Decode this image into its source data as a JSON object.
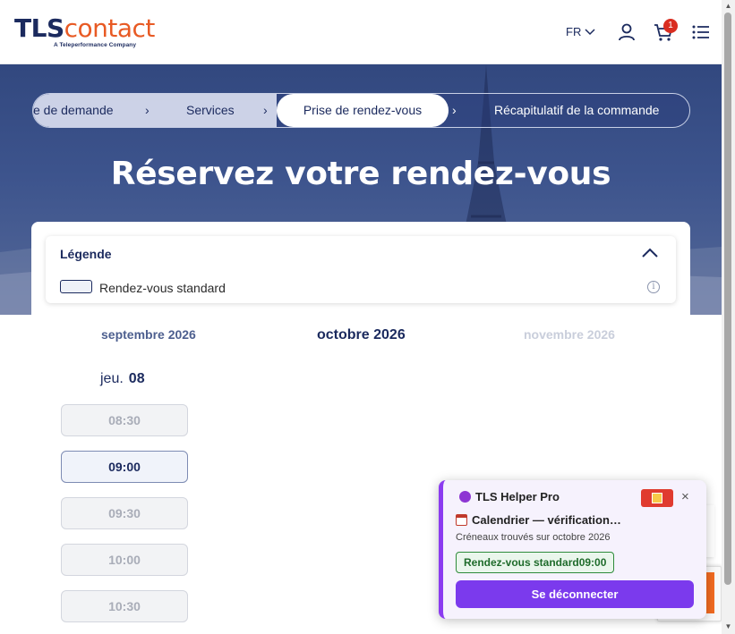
{
  "header": {
    "logo_tls": "TLS",
    "logo_contact": "contact",
    "logo_tagline": "A Teleperformance Company",
    "language": "FR",
    "cart_count": "1"
  },
  "stepper": {
    "steps": [
      "e de demande",
      "Services",
      "Prise de rendez-vous",
      "Récapitulatif de la commande"
    ],
    "active_index": 2
  },
  "hero": {
    "title": "Réservez votre rendez-vous"
  },
  "legend": {
    "title": "Légende",
    "items": [
      "Rendez-vous standard"
    ],
    "info_glyph": "i"
  },
  "calendar": {
    "months": {
      "prev": "septembre 2026",
      "current": "octobre 2026",
      "next": "novembre 2026"
    },
    "day": {
      "weekday": "jeu.",
      "number": "08"
    },
    "slots": [
      {
        "time": "08:30",
        "available": false
      },
      {
        "time": "09:00",
        "available": true
      },
      {
        "time": "09:30",
        "available": false
      },
      {
        "time": "10:00",
        "available": false
      },
      {
        "time": "10:30",
        "available": false
      }
    ]
  },
  "helper": {
    "title": "TLS Helper Pro",
    "status": "Calendrier — vérification…",
    "subtitle": "Créneaux trouvés sur octobre 2026",
    "badge": "Rendez-vous standard09:00",
    "logout_button": "Se déconnecter",
    "close": "×"
  },
  "colors": {
    "navy": "#1b2a5e",
    "orange": "#e85a24",
    "purple": "#7b3aed",
    "badge_red": "#d92d20",
    "success_green": "#1f6b2b"
  }
}
